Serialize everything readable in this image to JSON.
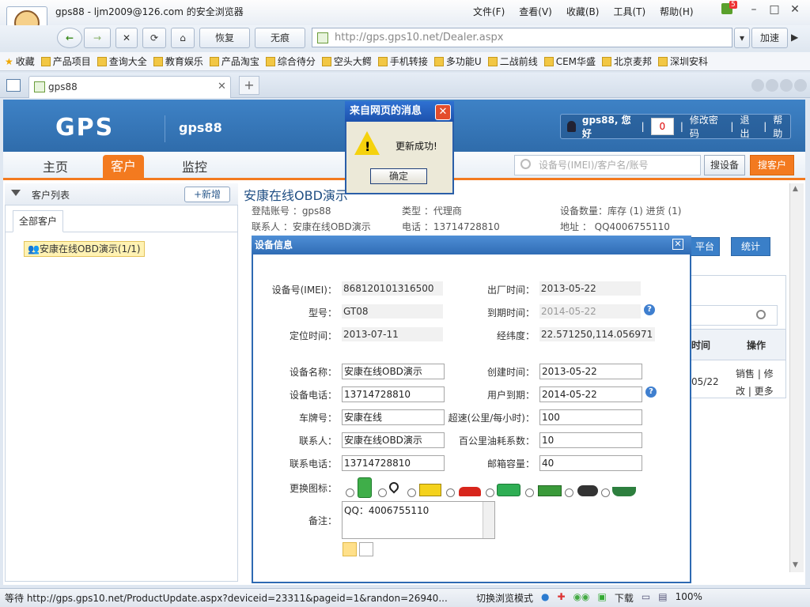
{
  "browser": {
    "window_title": "gps88 - ljm2009@126.com 的安全浏览器",
    "menu": [
      "文件(F)",
      "查看(V)",
      "收藏(B)",
      "工具(T)",
      "帮助(H)"
    ],
    "update_badge": "5",
    "nav": {
      "back": "←",
      "forward": "→",
      "stop": "✕",
      "refresh": "⟳",
      "home": "⌂",
      "restore": "恢复",
      "notrace": "无痕"
    },
    "address": "http://gps.gps10.net/Dealer.aspx",
    "accelerate": "加速",
    "bookmarks": [
      "收藏",
      "产品项目",
      "查询大全",
      "教育娱乐",
      "产品淘宝",
      "综合待分",
      "空头大鳄",
      "手机转接",
      "多功能U",
      "二战前线",
      "CEM华盛",
      "北京麦邦",
      "深圳安科"
    ],
    "tab_title": "gps88",
    "new_tab": "+"
  },
  "site": {
    "logo": "GPS",
    "brand": "gps88",
    "user_greeting": "gps88, 您好",
    "msg_count": "0",
    "links": [
      "修改密码",
      "退出",
      "帮助"
    ],
    "tabs": [
      "主页",
      "客户",
      "监控"
    ],
    "search_placeholder": "设备号(IMEI)/客户名/账号",
    "search_device": "搜设备",
    "search_customer": "搜客户"
  },
  "left": {
    "title": "客户列表",
    "new_button": "+新增",
    "all_tab": "全部客户",
    "tree_item": "安康在线OBD演示(1/1)"
  },
  "customer": {
    "name": "安康在线OBD演示",
    "account": "登陆账号 ：gps88",
    "type": "类型 ：代理商",
    "device_count": "设备数量：库存 (1) 进货 (1)",
    "contact": "联系人 ：安康在线OBD演示",
    "phone": "电话 ：13714728810",
    "address": "地址 ： QQ4006755110",
    "buttons": [
      "平台",
      "统计"
    ],
    "table": {
      "col_time": "时间",
      "col_ops": "操作",
      "row_date": "05/22",
      "ops": "销售 | 修改 | 更多"
    }
  },
  "device_dialog": {
    "title": "设备信息",
    "close": "✕",
    "labels": {
      "imei": "设备号(IMEI)：",
      "factory": "出厂时间：",
      "model": "型号：",
      "expire": "到期时间：",
      "loc_time": "定位时间：",
      "latlng": "经纬度：",
      "name": "设备名称：",
      "created": "创建时间：",
      "phone": "设备电话：",
      "user_expire": "用户到期：",
      "plate": "车牌号：",
      "overspeed": "超速(公里/每小时)：",
      "contact": "联系人：",
      "fuel": "百公里油耗系数：",
      "contact_phone": "联系电话：",
      "tank": "邮箱容量：",
      "icon": "更换图标：",
      "remark": "备注："
    },
    "values": {
      "imei": "868120101316500",
      "factory": "2013-05-22",
      "model": "GT08",
      "expire": "2014-05-22",
      "loc_time": "2013-07-11",
      "latlng": "22.571250,114.056971",
      "name": "安康在线OBD演示",
      "created": "2013-05-22",
      "phone": "13714728810",
      "user_expire": "2014-05-22",
      "plate": "安康在线",
      "overspeed": "100",
      "contact": "安康在线OBD演示",
      "fuel": "10",
      "contact_phone": "13714728810",
      "tank": "40",
      "remark": "QQ：4006755110"
    },
    "help": "?"
  },
  "alert": {
    "title": "来自网页的消息",
    "close": "✕",
    "message": "更新成功!",
    "ok": "确定"
  },
  "status": {
    "text": "等待 http://gps.gps10.net/ProductUpdate.aspx?deviceid=23311&pageid=1&randon=26940...",
    "switch_mode": "切换浏览模式",
    "download": "下载",
    "zoom": "100%"
  },
  "colors": {
    "accent": "#f37a1f",
    "header_blue": "#2f6cab"
  }
}
